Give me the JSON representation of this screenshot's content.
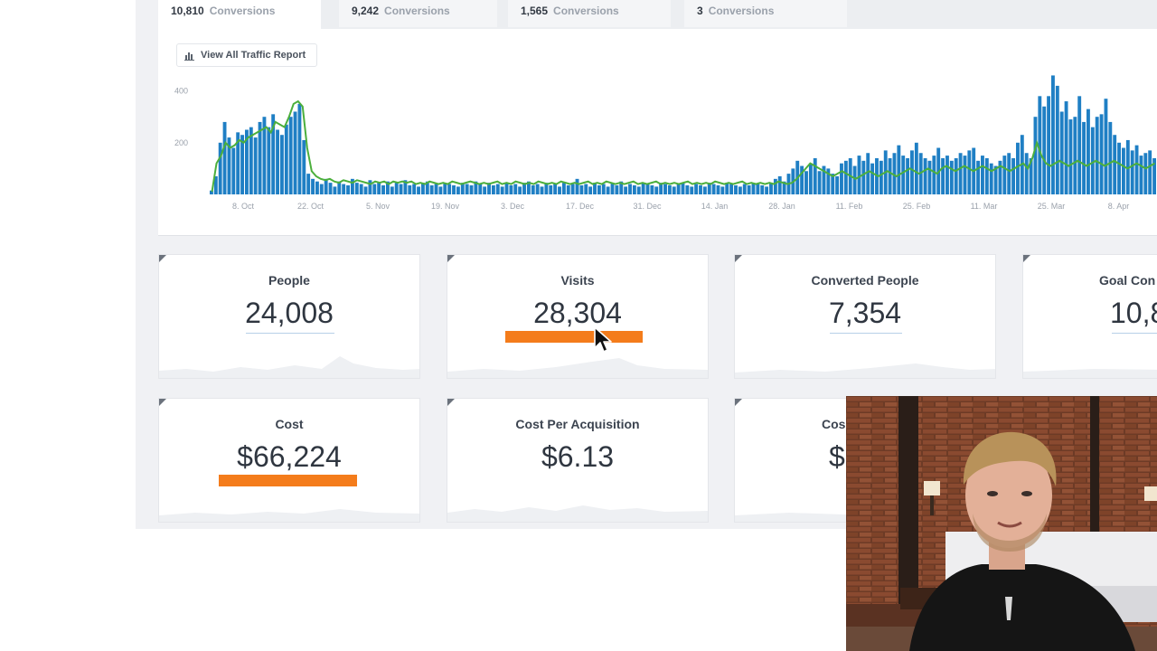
{
  "tabs": [
    {
      "value": "10,810",
      "label": "Conversions",
      "active": true
    },
    {
      "value": "9,242",
      "label": "Conversions",
      "active": false
    },
    {
      "value": "1,565",
      "label": "Conversions",
      "active": false
    },
    {
      "value": "3",
      "label": "Conversions",
      "active": false
    }
  ],
  "report_button": {
    "label": "View All Traffic Report",
    "icon": "bar-chart-icon"
  },
  "chart_data": {
    "type": "bar",
    "y_ticks": [
      "400",
      "200"
    ],
    "ylim": [
      0,
      500
    ],
    "x_tick_labels": [
      "8. Oct",
      "22. Oct",
      "5. Nov",
      "19. Nov",
      "3. Dec",
      "17. Dec",
      "31. Dec",
      "14. Jan",
      "28. Jan",
      "11. Feb",
      "25. Feb",
      "11. Mar",
      "25. Mar",
      "8. Apr"
    ],
    "colors": {
      "bars": "#1f7fc4",
      "line": "#4caf3c"
    },
    "series": [
      {
        "type": "bar",
        "values": [
          15,
          70,
          200,
          280,
          220,
          180,
          240,
          230,
          250,
          260,
          220,
          280,
          300,
          260,
          310,
          250,
          230,
          270,
          300,
          320,
          350,
          210,
          80,
          60,
          50,
          40,
          60,
          45,
          30,
          50,
          40,
          35,
          60,
          45,
          40,
          30,
          55,
          40,
          45,
          35,
          50,
          30,
          45,
          40,
          55,
          35,
          40,
          30,
          45,
          50,
          35,
          40,
          30,
          45,
          40,
          35,
          30,
          45,
          40,
          35,
          50,
          40,
          30,
          45,
          35,
          40,
          30,
          45,
          35,
          40,
          30,
          45,
          50,
          35,
          40,
          30,
          45,
          35,
          40,
          30,
          45,
          35,
          40,
          60,
          35,
          40,
          30,
          45,
          35,
          40,
          30,
          45,
          35,
          50,
          30,
          40,
          35,
          30,
          45,
          40,
          35,
          30,
          45,
          40,
          35,
          30,
          40,
          45,
          35,
          30,
          40,
          35,
          30,
          45,
          40,
          35,
          30,
          45,
          40,
          35,
          30,
          40,
          35,
          45,
          40,
          35,
          30,
          45,
          60,
          70,
          50,
          80,
          100,
          130,
          110,
          90,
          120,
          140,
          90,
          110,
          100,
          80,
          70,
          120,
          130,
          140,
          110,
          150,
          130,
          160,
          120,
          140,
          130,
          170,
          140,
          160,
          190,
          150,
          140,
          170,
          200,
          160,
          140,
          130,
          150,
          180,
          140,
          150,
          130,
          140,
          160,
          150,
          170,
          180,
          130,
          150,
          140,
          120,
          110,
          130,
          150,
          160,
          140,
          200,
          230,
          160,
          140,
          300,
          380,
          340,
          380,
          460,
          420,
          320,
          360,
          290,
          300,
          380,
          280,
          330,
          260,
          300,
          310,
          370,
          280,
          230,
          200,
          180,
          210,
          170,
          190,
          150,
          160,
          170,
          140
        ]
      },
      {
        "type": "line",
        "values": [
          10,
          120,
          150,
          200,
          180,
          190,
          210,
          200,
          220,
          230,
          240,
          250,
          260,
          240,
          280,
          270,
          260,
          300,
          350,
          360,
          340,
          180,
          90,
          70,
          60,
          55,
          60,
          50,
          45,
          55,
          50,
          45,
          55,
          50,
          45,
          40,
          50,
          45,
          50,
          40,
          50,
          45,
          50,
          45,
          50,
          40,
          45,
          40,
          50,
          45,
          40,
          45,
          40,
          50,
          45,
          40,
          45,
          50,
          45,
          40,
          45,
          40,
          45,
          50,
          40,
          45,
          40,
          50,
          45,
          40,
          45,
          40,
          50,
          45,
          40,
          45,
          40,
          50,
          45,
          40,
          45,
          40,
          45,
          50,
          40,
          45,
          40,
          50,
          45,
          40,
          45,
          40,
          45,
          50,
          40,
          45,
          40,
          45,
          50,
          40,
          45,
          40,
          45,
          40,
          45,
          50,
          40,
          45,
          40,
          45,
          40,
          50,
          45,
          40,
          45,
          40,
          45,
          50,
          40,
          45,
          40,
          45,
          40,
          45,
          40,
          50,
          45,
          40,
          45,
          60,
          80,
          100,
          120,
          110,
          100,
          90,
          80,
          70,
          80,
          90,
          80,
          70,
          60,
          70,
          80,
          90,
          80,
          70,
          80,
          90,
          80,
          70,
          80,
          90,
          100,
          90,
          80,
          90,
          100,
          90,
          80,
          100,
          110,
          100,
          90,
          100,
          110,
          100,
          90,
          100,
          110,
          100,
          90,
          100,
          110,
          100,
          90,
          100,
          110,
          120,
          100,
          140,
          200,
          150,
          120,
          110,
          120,
          130,
          120,
          110,
          120,
          130,
          120,
          110,
          120,
          130,
          120,
          110,
          120,
          130,
          120,
          110,
          100,
          110,
          120,
          110,
          100,
          110,
          120
        ]
      }
    ]
  },
  "metrics": [
    {
      "title": "People",
      "value": "24,008"
    },
    {
      "title": "Visits",
      "value": "28,304"
    },
    {
      "title": "Converted People",
      "value": "7,354"
    },
    {
      "title": "Goal Con",
      "value": "10,8"
    },
    {
      "title": "Cost",
      "value": "$66,224"
    },
    {
      "title": "Cost Per Acquisition",
      "value": "$6.13"
    },
    {
      "title": "Cos",
      "value": "$"
    }
  ],
  "webcam": {
    "description_icon": "presenter-video-feed"
  }
}
